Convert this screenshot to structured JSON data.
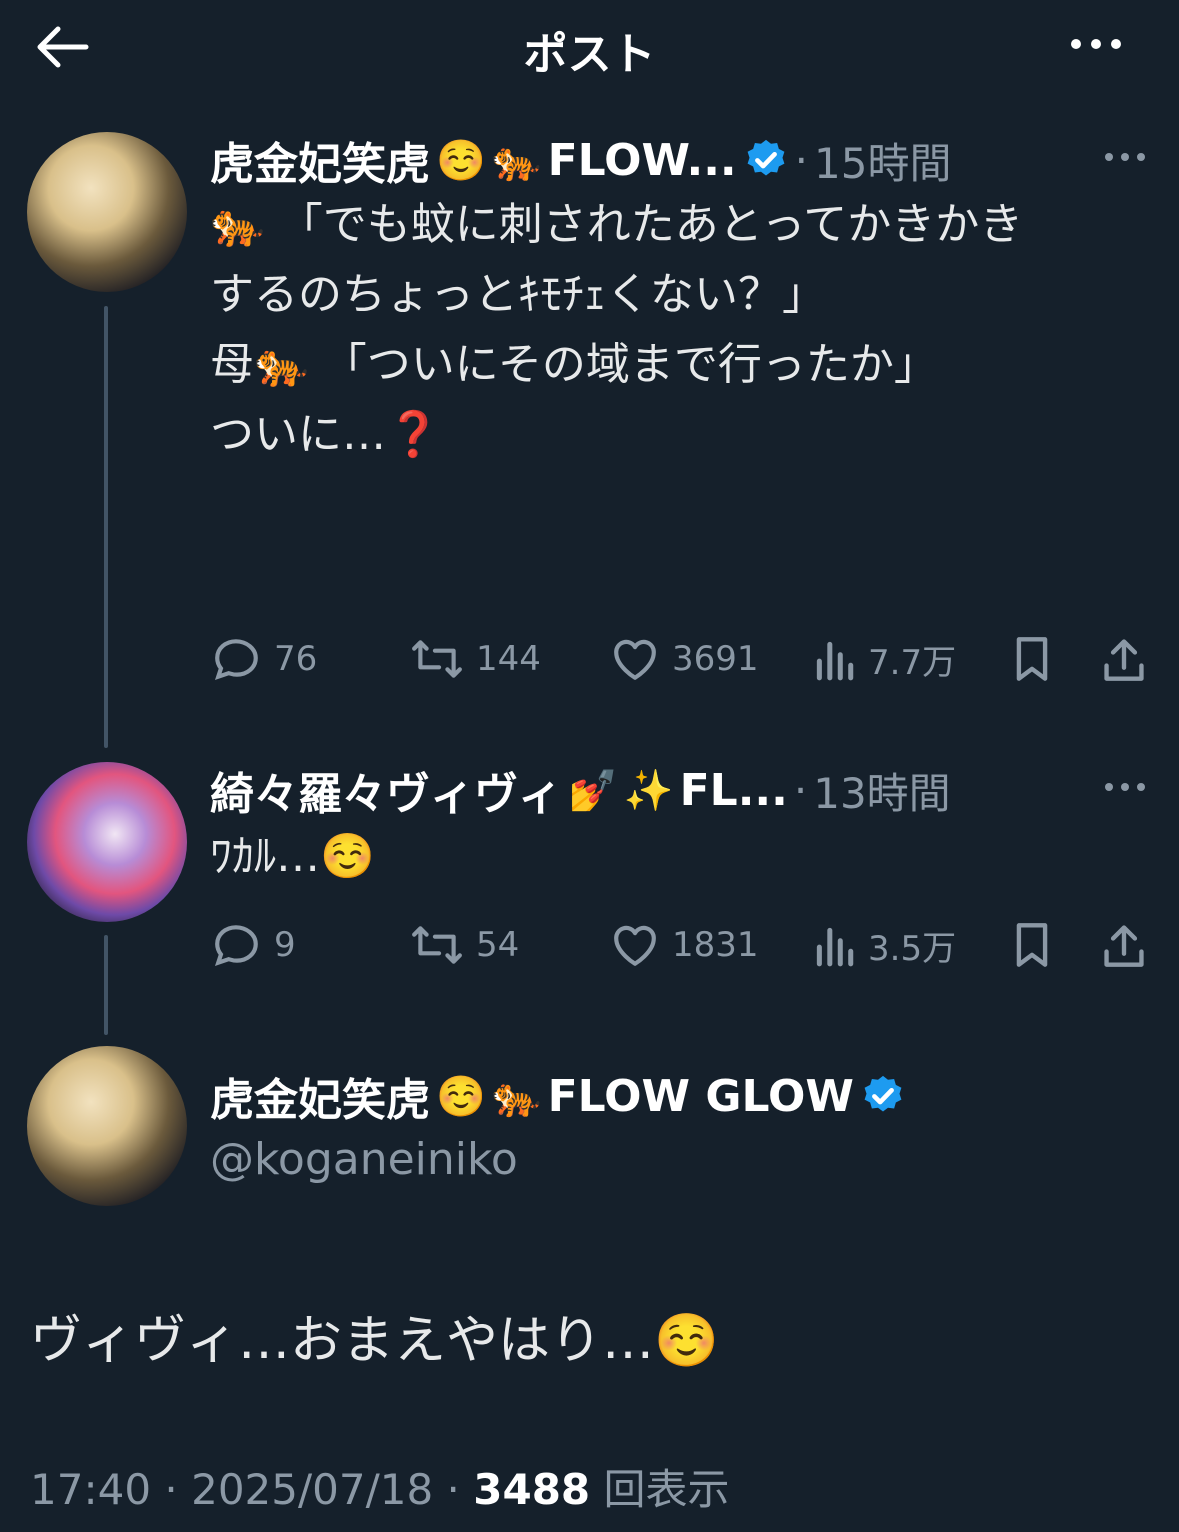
{
  "header": {
    "title": "ポスト"
  },
  "posts": [
    {
      "name": "虎金妃笑虎",
      "name_emoji": "☺️",
      "name_emoji2": "🐅",
      "name_suffix": "FLOW...",
      "time": "15時間",
      "text_lines": [
        "🐅 「でも蚊に刺されたあとってかきかき",
        "するのちょっとｷﾓﾁｪくない？」",
        "",
        "母🐅 「ついにその域まで行ったか」",
        "",
        "ついに…❓"
      ],
      "stats": {
        "replies": "76",
        "reposts": "144",
        "likes": "3691",
        "views": "7.7万"
      }
    },
    {
      "name": "綺々羅々ヴィヴィ",
      "name_emoji": "💅",
      "name_emoji2": "✨",
      "name_suffix": "FL...",
      "time": "13時間",
      "text_lines": [
        "ﾜｶﾙ…☺️"
      ],
      "stats": {
        "replies": "9",
        "reposts": "54",
        "likes": "1831",
        "views": "3.5万"
      }
    }
  ],
  "main_post": {
    "name": "虎金妃笑虎",
    "name_emoji": "☺️",
    "name_emoji2": "🐅",
    "name_suffix": "FLOW GLOW",
    "handle": "@koganeiniko",
    "text": "ヴィヴィ…おまえやはり…☺️",
    "time": "17:40",
    "date": "2025/07/18",
    "views_count": "3488",
    "views_label": "回表示"
  },
  "colors": {
    "background": "#15202b",
    "text": "#e7e9ea",
    "muted": "#8b98a5",
    "verified": "#1d9bf0"
  },
  "icons": [
    "back-arrow-icon",
    "more-icon",
    "verified-icon",
    "reply-icon",
    "repost-icon",
    "like-icon",
    "views-icon",
    "bookmark-icon",
    "share-icon"
  ]
}
